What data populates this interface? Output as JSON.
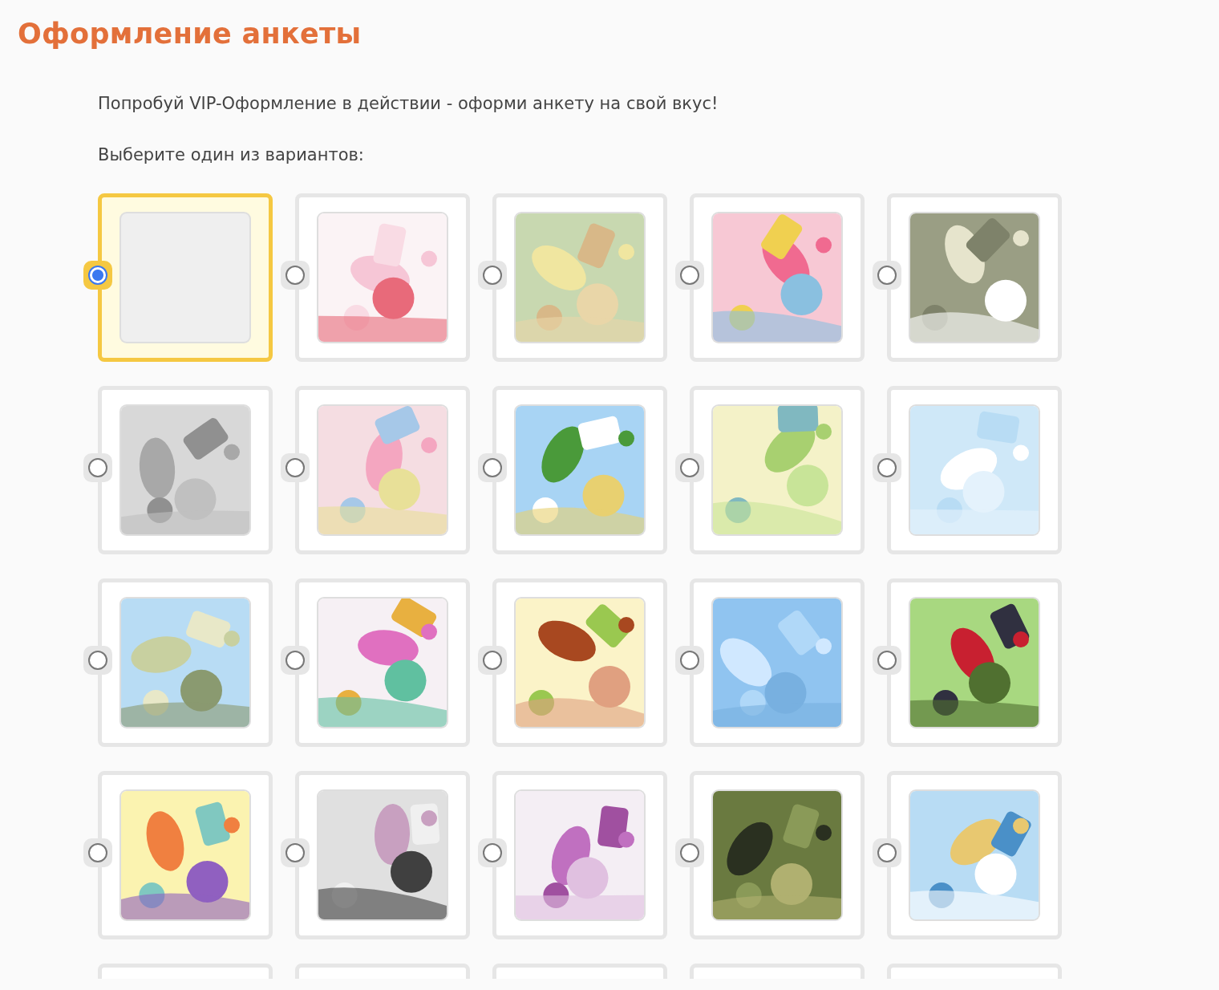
{
  "title": "Оформление анкеты",
  "intro": "Попробуй VIP-Оформление в действии - оформи анкету на свой вкус!",
  "prompt": "Выберите один из вариантов:",
  "options": [
    {
      "kind": "blank",
      "selected": true
    },
    {
      "kind": "picture",
      "selected": false
    },
    {
      "kind": "picture",
      "selected": false
    },
    {
      "kind": "picture",
      "selected": false
    },
    {
      "kind": "picture",
      "selected": false
    },
    {
      "kind": "picture",
      "selected": false
    },
    {
      "kind": "picture",
      "selected": false
    },
    {
      "kind": "picture",
      "selected": false
    },
    {
      "kind": "picture",
      "selected": false
    },
    {
      "kind": "picture",
      "selected": false
    },
    {
      "kind": "picture",
      "selected": false
    },
    {
      "kind": "picture",
      "selected": false
    },
    {
      "kind": "picture",
      "selected": false
    },
    {
      "kind": "picture",
      "selected": false
    },
    {
      "kind": "picture",
      "selected": false
    },
    {
      "kind": "picture",
      "selected": false
    },
    {
      "kind": "picture",
      "selected": false
    },
    {
      "kind": "picture",
      "selected": false
    },
    {
      "kind": "picture",
      "selected": false
    },
    {
      "kind": "picture",
      "selected": false
    }
  ],
  "partial_row": [
    {
      "kind": "card"
    },
    {
      "kind": "card"
    },
    {
      "kind": "card"
    },
    {
      "kind": "card"
    },
    {
      "kind": "card"
    }
  ]
}
